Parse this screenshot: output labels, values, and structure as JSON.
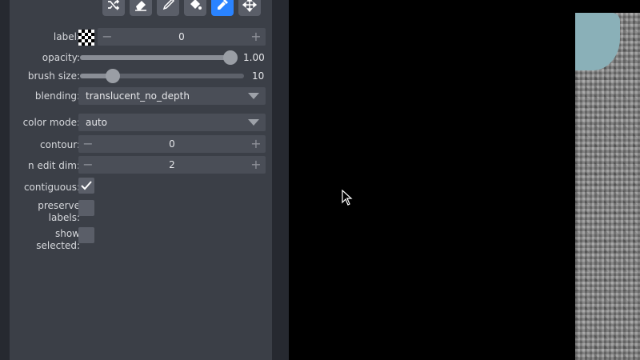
{
  "toolbar": {
    "tools": [
      {
        "icon": "shuffle-icon",
        "active": false
      },
      {
        "icon": "eraser-icon",
        "active": false
      },
      {
        "icon": "paintbrush-icon",
        "active": false
      },
      {
        "icon": "fill-bucket-icon",
        "active": false
      },
      {
        "icon": "color-picker-icon",
        "active": true
      },
      {
        "icon": "pan-zoom-icon",
        "active": false
      }
    ]
  },
  "controls": {
    "label": {
      "label": "label:",
      "value": "0"
    },
    "opacity": {
      "label": "opacity:",
      "value": "1.00",
      "level": 1.0
    },
    "brush_size": {
      "label": "brush size:",
      "value": "10",
      "level": 0.2
    },
    "blending": {
      "label": "blending:",
      "value": "translucent_no_depth"
    },
    "color_mode": {
      "label": "color mode:",
      "value": "auto"
    },
    "contour": {
      "label": "contour:",
      "value": "0"
    },
    "n_edit_dim": {
      "label": "n edit dim:",
      "value": "2"
    },
    "contiguous": {
      "label": "contiguous:",
      "checked": true
    },
    "preserve_labels": {
      "label_line1": "preserve",
      "label_line2": "labels:",
      "checked": false
    },
    "show_selected": {
      "label_line1": "show",
      "label_line2": "selected:",
      "checked": false
    }
  },
  "spin_symbols": {
    "minus": "−",
    "plus": "+"
  },
  "colors": {
    "accent": "#2a83ff",
    "panel": "#3b3f47",
    "label_blob": "#8ab0b8"
  }
}
